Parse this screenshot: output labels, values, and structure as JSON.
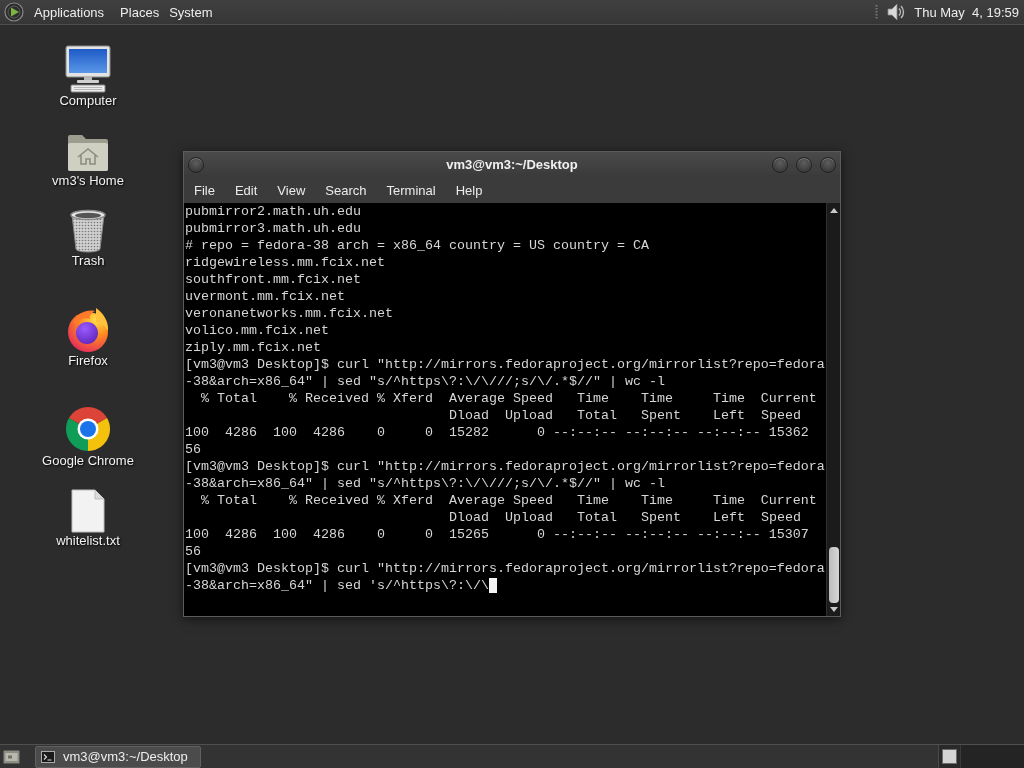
{
  "top_panel": {
    "menus": [
      "Applications",
      "Places",
      "System"
    ],
    "clock": "Thu May  4, 19:59"
  },
  "desktop_icons": [
    {
      "label": "Computer",
      "kind": "computer"
    },
    {
      "label": "vm3's Home",
      "kind": "home"
    },
    {
      "label": "Trash",
      "kind": "trash"
    },
    {
      "label": "Firefox",
      "kind": "firefox"
    },
    {
      "label": "Google Chrome",
      "kind": "chrome"
    },
    {
      "label": "whitelist.txt",
      "kind": "text-file"
    }
  ],
  "terminal_window": {
    "title": "vm3@vm3:~/Desktop",
    "menu": [
      "File",
      "Edit",
      "View",
      "Search",
      "Terminal",
      "Help"
    ],
    "lines": [
      "pubmirror2.math.uh.edu",
      "pubmirror3.math.uh.edu",
      "# repo = fedora-38 arch = x86_64 country = US country = CA",
      "ridgewireless.mm.fcix.net",
      "southfront.mm.fcix.net",
      "uvermont.mm.fcix.net",
      "veronanetworks.mm.fcix.net",
      "volico.mm.fcix.net",
      "ziply.mm.fcix.net",
      "[vm3@vm3 Desktop]$ curl \"http://mirrors.fedoraproject.org/mirrorlist?repo=fedora",
      "-38&arch=x86_64\" | sed \"s/^https\\?:\\/\\///;s/\\/.*$//\" | wc -l",
      "  % Total    % Received % Xferd  Average Speed   Time    Time     Time  Current",
      "                                 Dload  Upload   Total   Spent    Left  Speed",
      "100  4286  100  4286    0     0  15282      0 --:--:-- --:--:-- --:--:-- 15362",
      "56",
      "[vm3@vm3 Desktop]$ curl \"http://mirrors.fedoraproject.org/mirrorlist?repo=fedora",
      "-38&arch=x86_64\" | sed \"s/^https\\?:\\/\\///;s/\\/.*$//\" | wc -l",
      "  % Total    % Received % Xferd  Average Speed   Time    Time     Time  Current",
      "                                 Dload  Upload   Total   Spent    Left  Speed",
      "100  4286  100  4286    0     0  15265      0 --:--:-- --:--:-- --:--:-- 15307",
      "56",
      "[vm3@vm3 Desktop]$ curl \"http://mirrors.fedoraproject.org/mirrorlist?repo=fedora",
      "-38&arch=x86_64\" | sed 's/^https\\?:\\/\\"
    ],
    "cursor": true
  },
  "taskbar": {
    "windows": [
      {
        "title": "vm3@vm3:~/Desktop",
        "selected": true
      }
    ]
  }
}
